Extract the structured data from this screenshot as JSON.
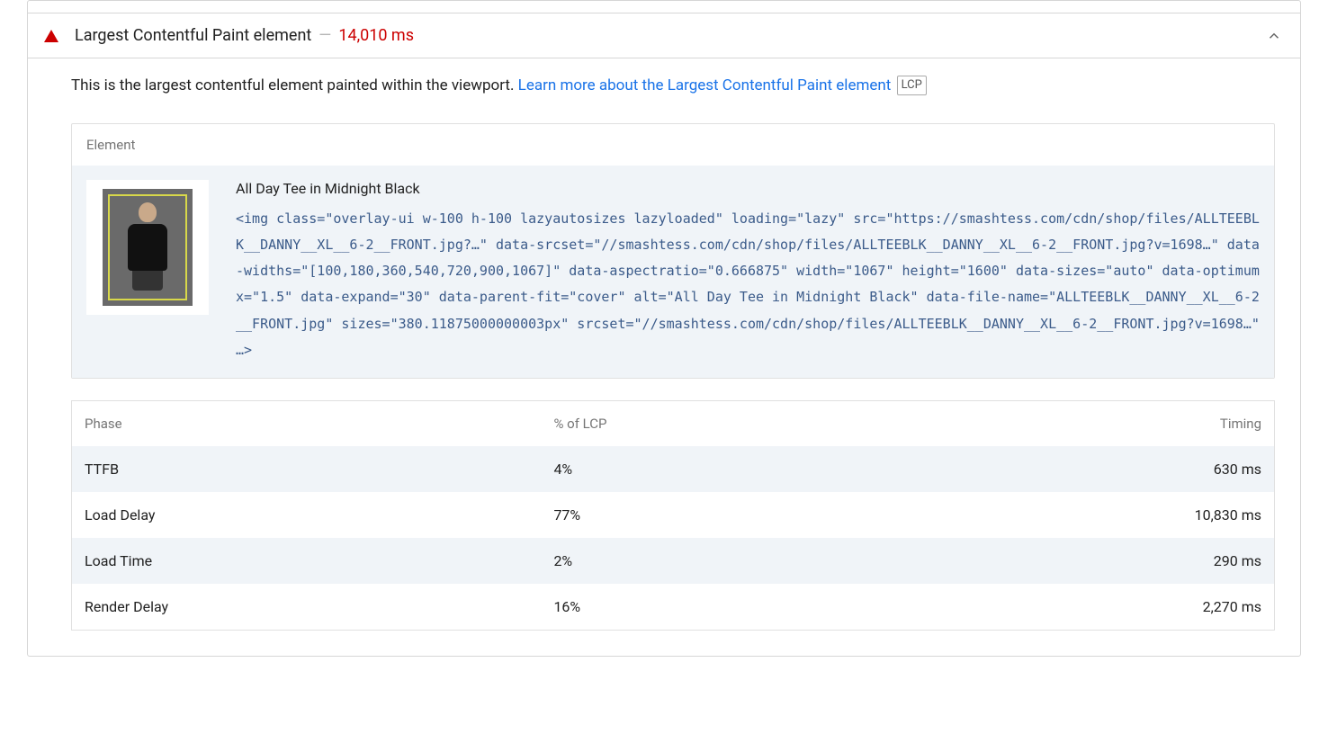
{
  "audit": {
    "title": "Largest Contentful Paint element",
    "value": "14,010 ms"
  },
  "description": {
    "text": "This is the largest contentful element painted within the viewport. ",
    "link_text": "Learn more about the Largest Contentful Paint element",
    "tag": "LCP"
  },
  "element": {
    "header": "Element",
    "node_label": "All Day Tee in Midnight Black",
    "snippet": "<img class=\"overlay-ui w-100 h-100 lazyautosizes lazyloaded\" loading=\"lazy\" src=\"https://smashtess.com/cdn/shop/files/ALLTEEBLK__DANNY__XL__6-2__FRONT.jpg?…\" data-srcset=\"//smashtess.com/cdn/shop/files/ALLTEEBLK__DANNY__XL__6-2__FRONT.jpg?v=1698…\" data-widths=\"[100,180,360,540,720,900,1067]\" data-aspectratio=\"0.666875\" width=\"1067\" height=\"1600\" data-sizes=\"auto\" data-optimumx=\"1.5\" data-expand=\"30\" data-parent-fit=\"cover\" alt=\"All Day Tee in Midnight Black\" data-file-name=\"ALLTEEBLK__DANNY__XL__6-2__FRONT.jpg\" sizes=\"380.11875000000003px\" srcset=\"//smashtess.com/cdn/shop/files/ALLTEEBLK__DANNY__XL__6-2__FRONT.jpg?v=1698…\" …>"
  },
  "phases": {
    "headers": {
      "phase": "Phase",
      "pct": "% of LCP",
      "timing": "Timing"
    },
    "rows": [
      {
        "phase": "TTFB",
        "pct": "4%",
        "timing": "630 ms"
      },
      {
        "phase": "Load Delay",
        "pct": "77%",
        "timing": "10,830 ms"
      },
      {
        "phase": "Load Time",
        "pct": "2%",
        "timing": "290 ms"
      },
      {
        "phase": "Render Delay",
        "pct": "16%",
        "timing": "2,270 ms"
      }
    ]
  }
}
